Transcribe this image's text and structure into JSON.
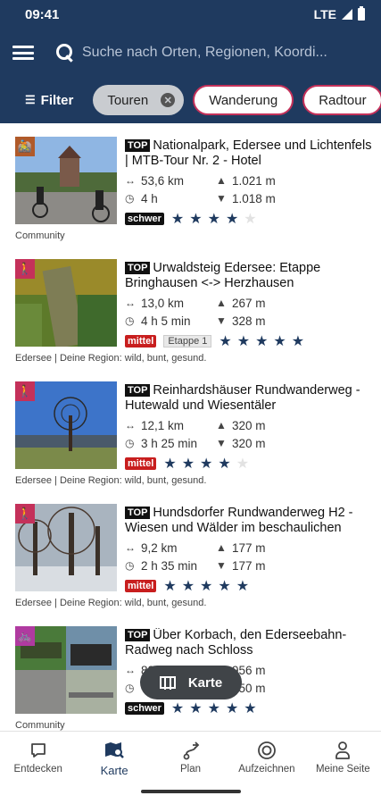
{
  "status": {
    "time": "09:41",
    "network": "LTE"
  },
  "search": {
    "placeholder": "Suche nach Orten, Regionen, Koordi..."
  },
  "filters": {
    "filter_label": "Filter",
    "chips": [
      {
        "label": "Touren",
        "active": true
      },
      {
        "label": "Wanderung",
        "active": false
      },
      {
        "label": "Radtour",
        "active": false
      }
    ]
  },
  "top_tag": "TOP",
  "tours": [
    {
      "type_icon": "mtb-icon",
      "title": "Nationalpark, Edersee und Lichtenfels | MTB-Tour Nr. 2 - Hotel",
      "distance": "53,6 km",
      "ascent": "1.021 m",
      "duration": "4 h",
      "descent": "1.018 m",
      "difficulty": "schwer",
      "stage": "",
      "rating": 4,
      "source": "Community"
    },
    {
      "type_icon": "hiking-icon",
      "title": "Urwaldsteig Edersee: Etappe Bringhausen <-> Herzhausen",
      "distance": "13,0 km",
      "ascent": "267 m",
      "duration": "4 h 5 min",
      "descent": "328 m",
      "difficulty": "mittel",
      "stage": "Etappe 1",
      "rating": 5,
      "source": "Edersee | Deine Region: wild, bunt, gesund."
    },
    {
      "type_icon": "hiking-icon",
      "title": "Reinhardshäuser Rundwanderweg - Hutewald und Wiesentäler",
      "distance": "12,1 km",
      "ascent": "320 m",
      "duration": "3 h 25 min",
      "descent": "320 m",
      "difficulty": "mittel",
      "stage": "",
      "rating": 4,
      "source": "Edersee | Deine Region: wild, bunt, gesund."
    },
    {
      "type_icon": "hiking-icon",
      "title": "Hundsdorfer Rundwanderweg H2 - Wiesen und Wälder im beschaulichen",
      "distance": "9,2 km",
      "ascent": "177 m",
      "duration": "2 h 35 min",
      "descent": "177 m",
      "difficulty": "mittel",
      "stage": "",
      "rating": 5,
      "source": "Edersee | Deine Region: wild, bunt, gesund."
    },
    {
      "type_icon": "bike-icon",
      "title": "Über Korbach, den Ederseebahn-Radweg nach Schloss",
      "distance": "82,0 km",
      "ascent": "956 m",
      "duration": "",
      "descent": "950 m",
      "difficulty": "schwer",
      "stage": "",
      "rating": 5,
      "source": "Community"
    }
  ],
  "map_button": {
    "label": "Karte"
  },
  "nav": [
    {
      "label": "Entdecken",
      "icon": "explore-icon",
      "active": false
    },
    {
      "label": "Karte",
      "icon": "map-search-icon",
      "active": true
    },
    {
      "label": "Plan",
      "icon": "route-icon",
      "active": false
    },
    {
      "label": "Aufzeichnen",
      "icon": "record-icon",
      "active": false
    },
    {
      "label": "Meine Seite",
      "icon": "profile-icon",
      "active": false
    }
  ],
  "colors": {
    "header": "#1f3a5f",
    "accent": "#c4315a",
    "hiking_badge": "#c4315a",
    "bike_badge": "#b03aa0",
    "mtb_badge": "#b05a2a",
    "difficulty_medium": "#c81e1e",
    "difficulty_hard": "#111111"
  }
}
